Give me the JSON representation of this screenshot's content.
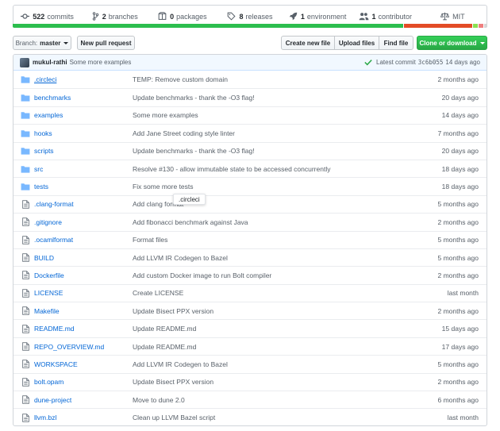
{
  "summary": {
    "commits": {
      "count": "522",
      "label": "commits"
    },
    "branches": {
      "count": "2",
      "label": "branches"
    },
    "packages": {
      "count": "0",
      "label": "packages"
    },
    "releases": {
      "count": "8",
      "label": "releases"
    },
    "environments": {
      "count": "1",
      "label": "environment"
    },
    "contributors": {
      "count": "1",
      "label": "contributor"
    },
    "license": "MIT"
  },
  "languages": [
    {
      "color": "#2cbe4e",
      "fraction": 0.822
    },
    {
      "color": "#e34c26",
      "fraction": 0.146
    },
    {
      "color": "#89e051",
      "fraction": 0.012
    },
    {
      "color": "#ef7f7f",
      "fraction": 0.012
    },
    {
      "color": "#d6d6d6",
      "fraction": 0.008
    }
  ],
  "toolbar": {
    "branch_prefix": "Branch:",
    "branch_name": "master",
    "new_pull_request": "New pull request",
    "create_new_file": "Create new file",
    "upload_files": "Upload files",
    "find_file": "Find file",
    "clone_or_download": "Clone or download"
  },
  "latest_commit": {
    "author": "mukul-rathi",
    "message": "Some more examples",
    "label": "Latest commit",
    "sha": "3c6b055",
    "age": "14 days ago"
  },
  "files": [
    {
      "type": "dir",
      "name": ".circleci",
      "message": "TEMP: Remove custom domain",
      "age": "2 months ago"
    },
    {
      "type": "dir",
      "name": "benchmarks",
      "message": "Update benchmarks - thank the -O3 flag!",
      "age": "20 days ago"
    },
    {
      "type": "dir",
      "name": "examples",
      "message": "Some more examples",
      "age": "14 days ago"
    },
    {
      "type": "dir",
      "name": "hooks",
      "message": "Add Jane Street coding style linter",
      "age": "7 months ago"
    },
    {
      "type": "dir",
      "name": "scripts",
      "message": "Update benchmarks - thank the -O3 flag!",
      "age": "20 days ago"
    },
    {
      "type": "dir",
      "name": "src",
      "message": "Resolve #130 - allow immutable state to be accessed concurrently",
      "age": "18 days ago"
    },
    {
      "type": "dir",
      "name": "tests",
      "message": "Fix some more tests",
      "age": "18 days ago"
    },
    {
      "type": "file",
      "name": ".clang-format",
      "message": "Add clang format",
      "age": "5 months ago"
    },
    {
      "type": "file",
      "name": ".gitignore",
      "message": "Add fibonacci benchmark against Java",
      "age": "2 months ago"
    },
    {
      "type": "file",
      "name": ".ocamlformat",
      "message": "Format files",
      "age": "5 months ago"
    },
    {
      "type": "file",
      "name": "BUILD",
      "message": "Add LLVM IR Codegen to Bazel",
      "age": "5 months ago"
    },
    {
      "type": "file",
      "name": "Dockerfile",
      "message": "Add custom Docker image to run Bolt compiler",
      "age": "2 months ago"
    },
    {
      "type": "file",
      "name": "LICENSE",
      "message": "Create LICENSE",
      "age": "last month"
    },
    {
      "type": "file",
      "name": "Makefile",
      "message": "Update Bisect PPX version",
      "age": "2 months ago"
    },
    {
      "type": "file",
      "name": "README.md",
      "message": "Update README.md",
      "age": "15 days ago"
    },
    {
      "type": "file",
      "name": "REPO_OVERVIEW.md",
      "message": "Update README.md",
      "age": "17 days ago"
    },
    {
      "type": "file",
      "name": "WORKSPACE",
      "message": "Add LLVM IR Codegen to Bazel",
      "age": "5 months ago"
    },
    {
      "type": "file",
      "name": "bolt.opam",
      "message": "Update Bisect PPX version",
      "age": "2 months ago"
    },
    {
      "type": "file",
      "name": "dune-project",
      "message": "Move to dune 2.0",
      "age": "6 months ago"
    },
    {
      "type": "file",
      "name": "llvm.bzl",
      "message": "Clean up LLVM Bazel script",
      "age": "last month"
    }
  ],
  "tooltip": ".circleci"
}
